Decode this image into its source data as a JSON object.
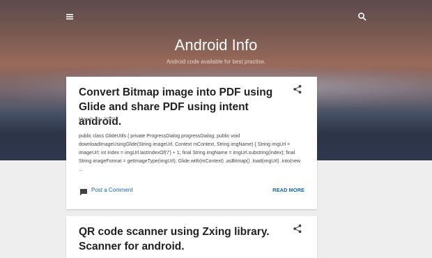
{
  "header": {
    "title": "Android Info",
    "description": "Android code available for best practise.",
    "menu_icon": "menu-icon",
    "search_icon": "search-icon"
  },
  "posts": [
    {
      "title": "Convert Bitmap image into PDF using Glide and share PDF using intent android.",
      "date": "March 21, 2020",
      "snippet": "public class GlideUtils {      private ProgressDialog progressDialog;      public void downloadImageUsingGlide(String imageUrl, Context mContext, String imgName) {          String imgUrl = imageUrl;          int index = imgUrl.lastIndexOf('/') + 1;          final String imgName = imgUrl.substring(index);          final String imageFormat = getImageType(imgUrl);          Glide.with(mContext)              .asBitmap()              .load(imgUrl)              .into(new          …",
      "comment_label": "Post a Comment",
      "read_more_label": "READ MORE",
      "share_icon": "share-icon",
      "comment_icon": "comment-icon"
    },
    {
      "title": "QR code scanner using Zxing library. Scanner for android.",
      "share_icon": "share-icon"
    }
  ],
  "colors": {
    "link": "#1565c0",
    "title": "#212121",
    "background": "#eeeeee"
  }
}
